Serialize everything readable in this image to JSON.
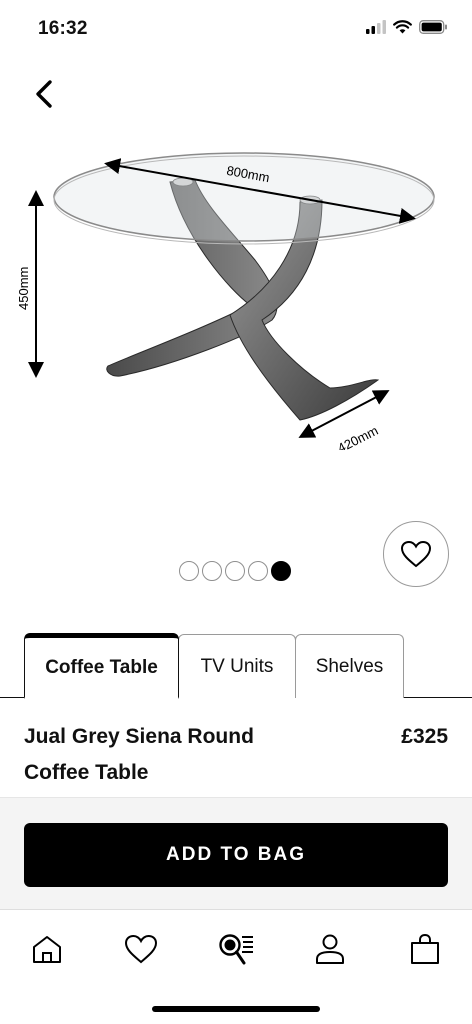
{
  "status_bar": {
    "time": "16:32"
  },
  "product_image": {
    "dim_diameter": "800mm",
    "dim_height": "450mm",
    "dim_depth": "420mm"
  },
  "carousel": {
    "total": 5,
    "active_index": 5
  },
  "tabs": [
    {
      "label": "Coffee Table",
      "active": true
    },
    {
      "label": "TV Units",
      "active": false
    },
    {
      "label": "Shelves",
      "active": false
    }
  ],
  "product": {
    "name": "Jual Grey Siena Round Coffee Table",
    "price": "£325"
  },
  "cta": {
    "add_to_bag_label": "ADD TO BAG"
  },
  "bottom_nav": {
    "items": [
      "home-icon",
      "heart-icon",
      "search-list-icon",
      "account-icon",
      "bag-icon"
    ]
  },
  "colors": {
    "primary": "#000000",
    "background": "#ffffff",
    "cta_area": "#f4f4f4"
  }
}
